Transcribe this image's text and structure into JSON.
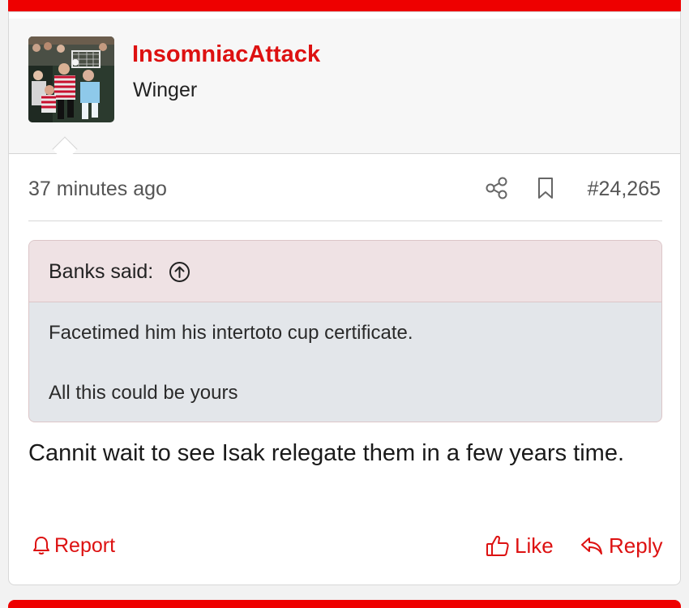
{
  "post": {
    "username": "InsomniacAttack",
    "user_title": "Winger",
    "time": "37 minutes ago",
    "post_number": "#24,265",
    "quote": {
      "author": "Banks said:",
      "lines": [
        "Facetimed him his intertoto cup certificate.",
        "All this could be yours"
      ]
    },
    "message": "Cannit wait to see Isak relegate them in a few years time.",
    "actions": {
      "report": "Report",
      "like": "Like",
      "reply": "Reply"
    }
  },
  "icons": {
    "share": "share-icon",
    "bookmark": "bookmark-icon",
    "quote_jump": "arrow-up-circle-icon",
    "report": "bell-icon",
    "like": "thumbs-up-icon",
    "reply": "reply-icon"
  },
  "colors": {
    "accent": "#ee0000",
    "link": "#dd1111",
    "quote_header_bg": "#efe2e4",
    "quote_body_bg": "#e3e6ea"
  }
}
